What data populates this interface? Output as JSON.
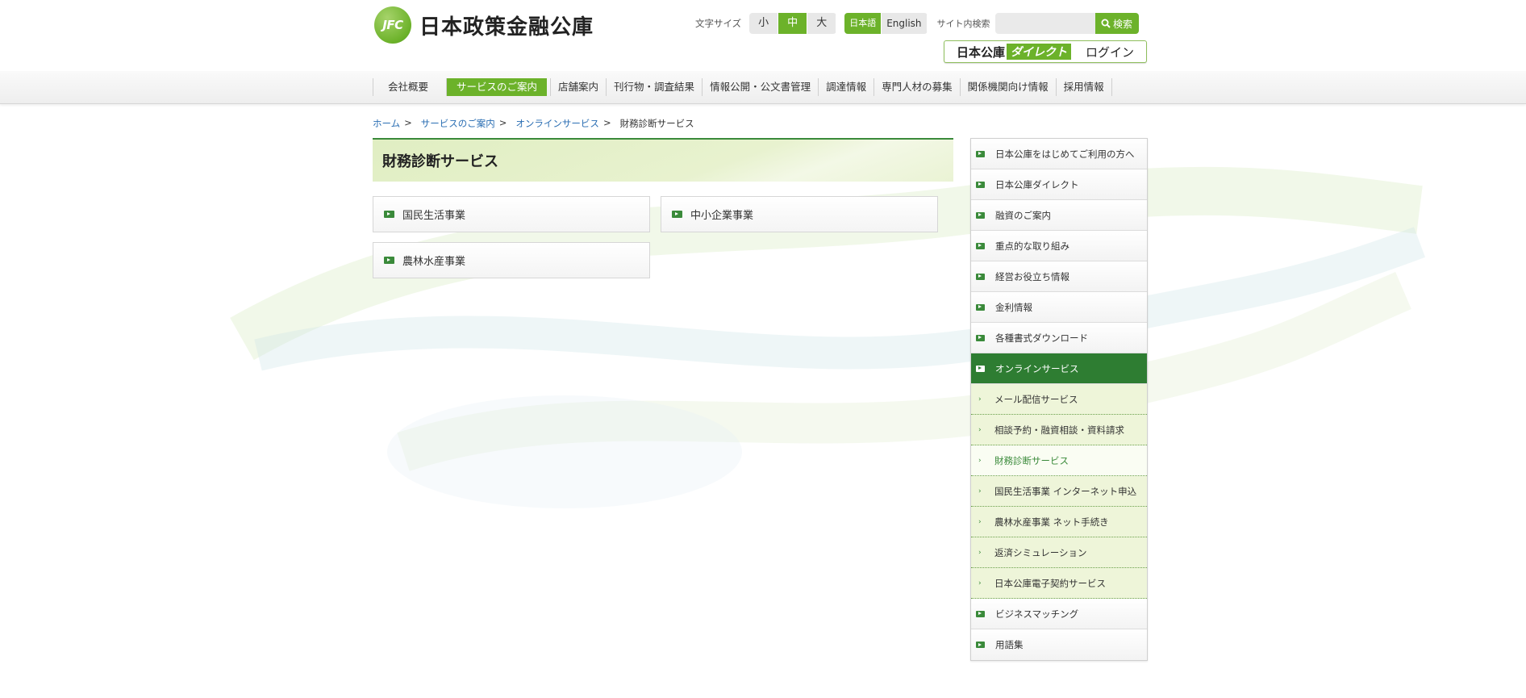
{
  "header": {
    "logo_mark": "JFC",
    "logo_text": "日本政策金融公庫",
    "font_size_label": "文字サイズ",
    "font_sizes": [
      "小",
      "中",
      "大"
    ],
    "languages": [
      "日本語",
      "English"
    ],
    "search_label": "サイト内検索",
    "search_placeholder": "",
    "search_button": "検索",
    "direct_prefix": "日本公庫",
    "direct_tag": "ダイレクト",
    "direct_login": "ログイン"
  },
  "gnav": [
    "会社概要",
    "サービスのご案内",
    "店舗案内",
    "刊行物・調査結果",
    "情報公開・公文書管理",
    "調達情報",
    "専門人材の募集",
    "関係機関向け情報",
    "採用情報"
  ],
  "breadcrumb": [
    "ホーム",
    "サービスのご案内",
    "オンラインサービス",
    "財務診断サービス"
  ],
  "main": {
    "title": "財務診断サービス",
    "cards": [
      "国民生活事業",
      "中小企業事業",
      "農林水産事業"
    ]
  },
  "side": [
    "日本公庫をはじめてご利用の方へ",
    "日本公庫ダイレクト",
    "融資のご案内",
    "重点的な取り組み",
    "経営お役立ち情報",
    "金利情報",
    "各種書式ダウンロード",
    "オンラインサービス",
    "メール配信サービス",
    "相談予約・融資相談・資料請求",
    "財務診断サービス",
    "国民生活事業 インターネット申込",
    "農林水産事業 ネット手続き",
    "返済シミュレーション",
    "日本公庫電子契約サービス",
    "ビジネスマッチング",
    "用語集"
  ],
  "colors": {
    "accent": "#6cb22a",
    "dark_green": "#2e7d32",
    "link": "#2a6eb3"
  }
}
